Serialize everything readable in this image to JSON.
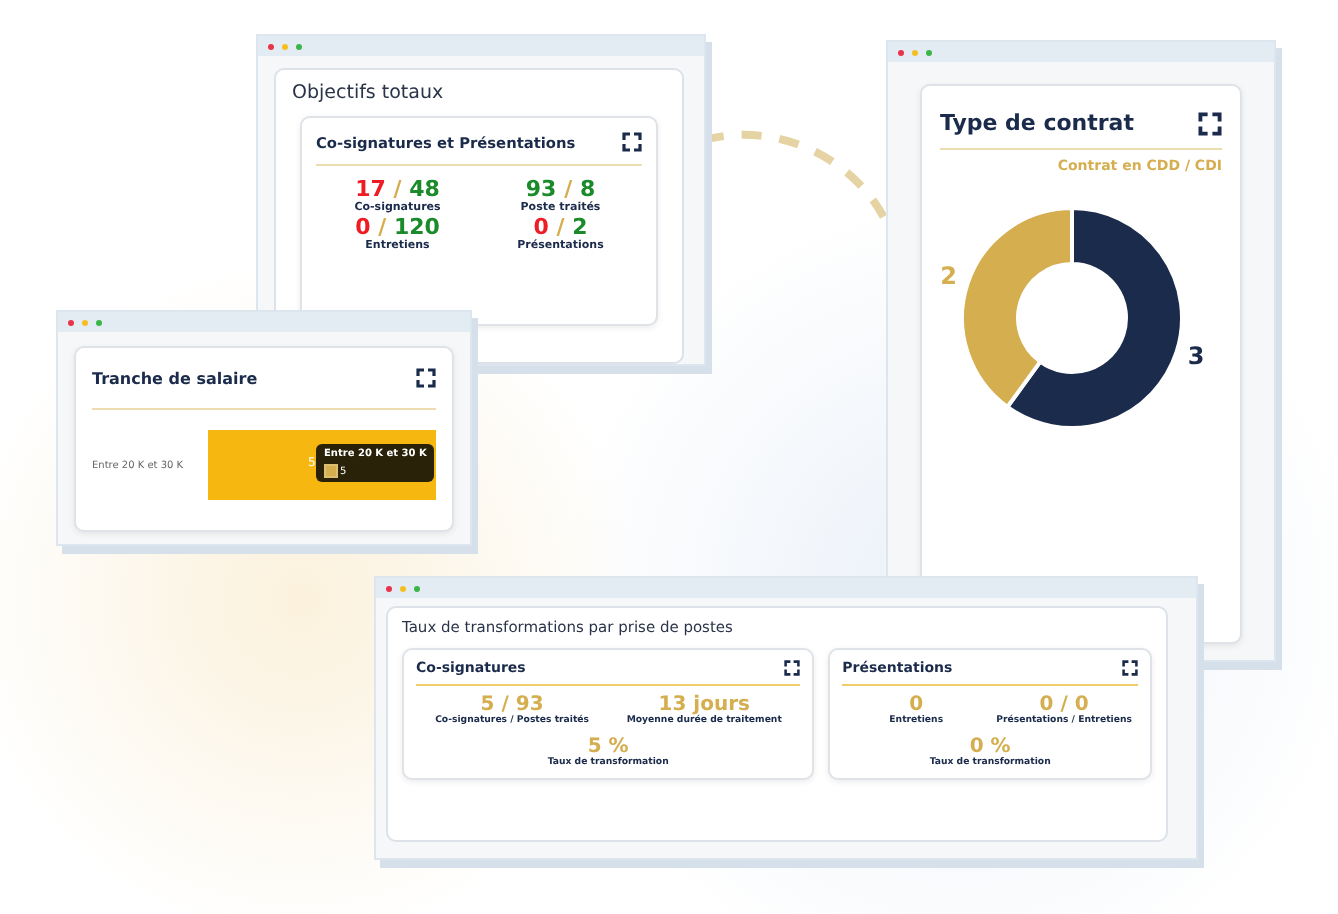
{
  "objectives_window": {
    "title": "Objectifs totaux",
    "card": {
      "title": "Co-signatures et Présentations",
      "stats": [
        {
          "current": "17",
          "current_on_track": false,
          "separator": "/",
          "target": "48",
          "label": "Co-signatures"
        },
        {
          "current": "93",
          "current_on_track": true,
          "separator": "/",
          "target": "8",
          "label": "Poste traités"
        },
        {
          "current": "0",
          "current_on_track": false,
          "separator": "/",
          "target": "120",
          "label": "Entretiens"
        },
        {
          "current": "0",
          "current_on_track": false,
          "separator": "/",
          "target": "2",
          "label": "Présentations"
        }
      ]
    }
  },
  "contract_window": {
    "title": "Type de contrat",
    "subtitle": "Contrat en CDD / CDI",
    "chart_data": {
      "type": "donut",
      "values": [
        3,
        2
      ],
      "data_labels": true
    }
  },
  "salary_window": {
    "title": "Tranche de salaire",
    "bars": [
      {
        "category": "Entre 20 K et 30 K",
        "value_label": "5"
      }
    ],
    "tooltip": {
      "title": "Entre 20 K et 30 K",
      "value": "5"
    }
  },
  "rates_window": {
    "title": "Taux de transformations par prise de postes",
    "cards": [
      {
        "title": "Co-signatures",
        "metrics": [
          {
            "value": "5 / 93",
            "label": "Co-signatures / Postes traités"
          },
          {
            "value": "13 jours",
            "label": "Moyenne durée de traitement"
          },
          {
            "value": "5 %",
            "label": "Taux de transformation"
          }
        ]
      },
      {
        "title": "Présentations",
        "metrics": [
          {
            "value": "0",
            "label": "Entretiens"
          },
          {
            "value": "0 / 0",
            "label": "Présentations / Entretiens"
          },
          {
            "value": "0 %",
            "label": "Taux de transformation"
          }
        ]
      }
    ]
  }
}
